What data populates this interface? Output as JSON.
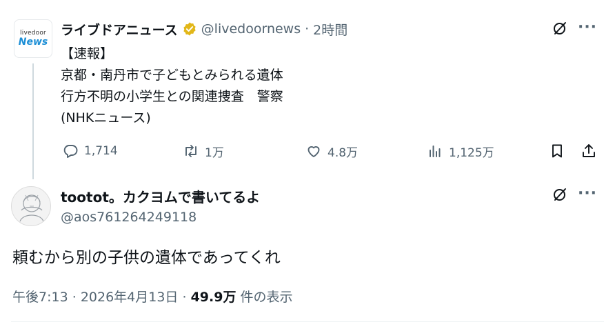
{
  "parent_tweet": {
    "avatar": {
      "line1": "livedoor",
      "line2": "News"
    },
    "display_name": "ライブドアニュース",
    "handle": "@livedoornews",
    "separator": "·",
    "time": "2時間",
    "text": "【速報】\n京都・南丹市で子どもとみられる遺体\n行方不明の小学生との関連捜査　警察\n(NHKニュース)",
    "actions": {
      "reply_count": "1,714",
      "retweet_count": "1万",
      "like_count": "4.8万",
      "view_count": "1,125万"
    },
    "more": "···"
  },
  "reply_tweet": {
    "display_name": "tootot。カクヨムで書いてるよ",
    "handle": "@aos761264249118",
    "text": "頼むから別の子供の遺体であってくれ",
    "time": "午後7:13",
    "date": "2026年4月13日",
    "dot": "·",
    "views": "49.9万",
    "views_label": "件の表示",
    "more": "···"
  },
  "colors": {
    "text": "#0f1419",
    "muted": "#536471",
    "verified": "#e2b719",
    "brand": "#1d8fd6"
  },
  "icons": [
    "grok-icon",
    "more-icon",
    "reply-icon",
    "retweet-icon",
    "like-icon",
    "views-icon",
    "bookmark-icon",
    "share-icon",
    "verified-badge-icon"
  ]
}
